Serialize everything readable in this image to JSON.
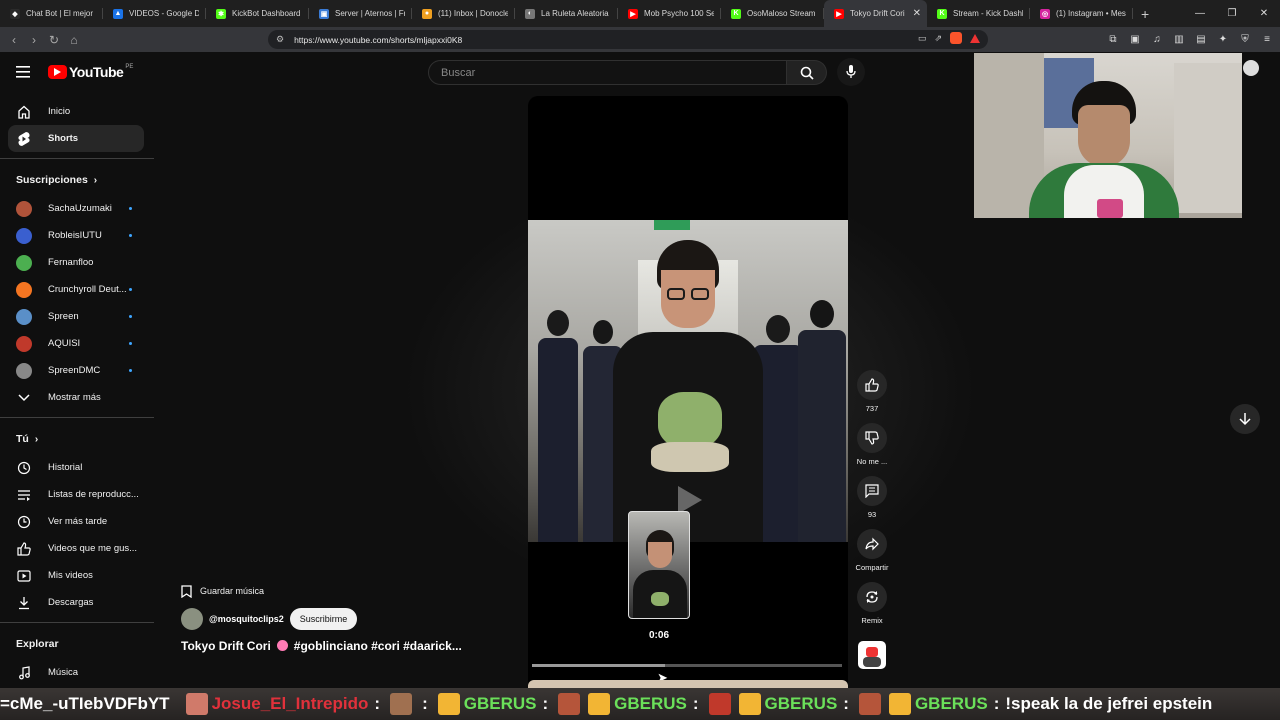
{
  "browser": {
    "tabs": [
      {
        "title": "Chat Bot | El mejor",
        "color": "#2b2b2b",
        "glyph": "◆"
      },
      {
        "title": "VIDEOS - Google Drive",
        "color": "#1a73e8",
        "glyph": "▲"
      },
      {
        "title": "KickBot Dashboard",
        "color": "#53fc18",
        "glyph": "✱"
      },
      {
        "title": "Server | Aternos | Free",
        "color": "#3a7bd5",
        "glyph": "▣"
      },
      {
        "title": "(11) Inbox | Donocle",
        "color": "#f0a020",
        "glyph": "●"
      },
      {
        "title": "La Ruleta Aleatoria",
        "color": "#777777",
        "glyph": "◐"
      },
      {
        "title": "Mob Psycho 100 Se",
        "color": "#ff0000",
        "glyph": "▶"
      },
      {
        "title": "OsoMaloso Stream",
        "color": "#53fc18",
        "glyph": "K"
      },
      {
        "title": "Tokyo Drift Cori",
        "color": "#ff0000",
        "glyph": "▶",
        "active": true
      },
      {
        "title": "Stream - Kick Dashboard",
        "color": "#53fc18",
        "glyph": "K"
      },
      {
        "title": "(1) Instagram • Messages",
        "color": "#d6249f",
        "glyph": "◎"
      }
    ],
    "url": "https://www.youtube.com/shorts/mljapxxi0K8"
  },
  "header": {
    "logo_text": "YouTube",
    "country_code": "PE",
    "search_placeholder": "Buscar"
  },
  "sidebar": {
    "main": [
      {
        "label": "Inicio",
        "icon": "home-icon"
      },
      {
        "label": "Shorts",
        "icon": "shorts-icon",
        "active": true
      }
    ],
    "subscriptions_heading": "Suscripciones",
    "subscriptions": [
      {
        "label": "SachaUzumaki",
        "color": "#b0533a"
      },
      {
        "label": "RobleisIUTU",
        "color": "#3a5fcf"
      },
      {
        "label": "Fernanfloo",
        "color": "#4caf50"
      },
      {
        "label": "Crunchyroll Deut...",
        "color": "#f47521"
      },
      {
        "label": "Spreen",
        "color": "#5a8fc8"
      },
      {
        "label": "AQUISI",
        "color": "#c0392b"
      },
      {
        "label": "SpreenDMC",
        "color": "#888888"
      }
    ],
    "show_more": "Mostrar más",
    "you_heading": "Tú",
    "you_items": [
      {
        "label": "Historial",
        "icon": "history-icon"
      },
      {
        "label": "Listas de reproducc...",
        "icon": "playlists-icon"
      },
      {
        "label": "Ver más tarde",
        "icon": "watch-later-icon"
      },
      {
        "label": "Videos que me gus...",
        "icon": "liked-videos-icon"
      },
      {
        "label": "Mis videos",
        "icon": "my-videos-icon"
      },
      {
        "label": "Descargas",
        "icon": "downloads-icon"
      }
    ],
    "explore_heading": "Explorar",
    "explore_items": [
      {
        "label": "Música",
        "icon": "music-icon"
      }
    ]
  },
  "short": {
    "save_music": "Guardar música",
    "channel": "@mosquitoclips2",
    "subscribe": "Suscribirme",
    "title_part1": "Tokyo Drift Cori",
    "title_part2": "#goblinciano #cori #daarick...",
    "preview_time": "0:06",
    "progress": 0.43
  },
  "actions": {
    "likes": "737",
    "dislike": "No me ...",
    "comments": "93",
    "share": "Compartir",
    "remix": "Remix"
  },
  "ticker": {
    "start": "=cMe_-uTIebVDFbYT",
    "user1": "Josue_El_Intrepido",
    "user2": "GBERUS",
    "user3": "GBERUS",
    "user4": "GBERUS",
    "user5": "GBERUS",
    "last_message": "!speak la de jefrei epstein"
  }
}
